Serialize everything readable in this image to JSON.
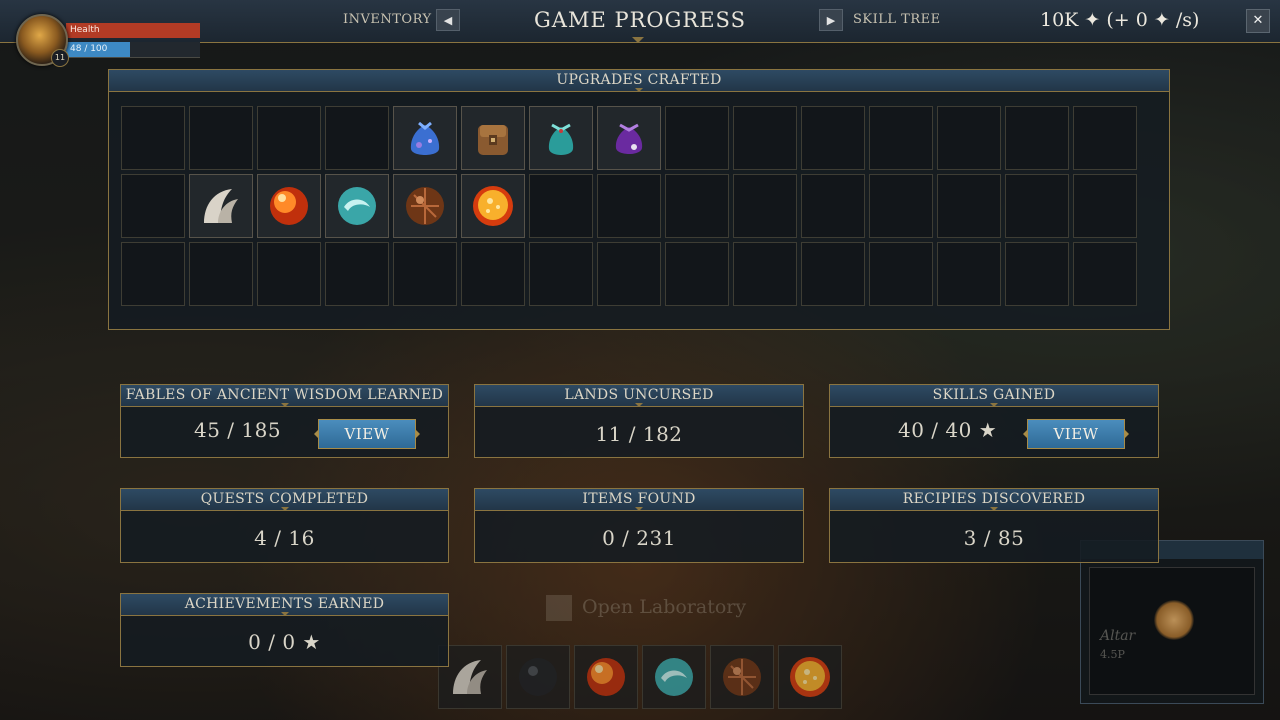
{
  "hud": {
    "level": "11",
    "health_label": "Health",
    "mana_value": "48 / 100",
    "mana_fraction": 0.48
  },
  "topbar": {
    "inventory_label": "INVENTORY",
    "title": "GAME PROGRESS",
    "skill_tree_label": "SKILL TREE",
    "currency": "10K ✦ (+ 0 ✦ /s)",
    "prev_icon": "triangle-left-icon",
    "next_icon": "triangle-right-icon",
    "close_icon": "close-icon"
  },
  "upgrades": {
    "title": "UPGRADES CRAFTED",
    "slots": [
      "",
      "",
      "",
      "",
      "blue-pouch",
      "leather-backpack",
      "teal-pouch",
      "purple-pouch",
      "",
      "",
      "",
      "",
      "",
      "",
      "",
      "",
      "claw",
      "fire-orb",
      "water-orb",
      "bronze-orb",
      "sun-orb",
      "",
      "",
      "",
      "",
      "",
      "",
      "",
      "",
      "",
      "",
      "",
      "",
      "",
      "",
      "",
      "",
      "",
      "",
      "",
      "",
      "",
      "",
      "",
      ""
    ]
  },
  "stats": {
    "fables": {
      "title": "FABLES OF ANCIENT WISDOM LEARNED",
      "value": "45 / 185",
      "button": "VIEW"
    },
    "lands": {
      "title": "LANDS UNCURSED",
      "value": "11 / 182"
    },
    "skills": {
      "title": "SKILLS GAINED",
      "value": "40 / 40 ★",
      "button": "VIEW"
    },
    "quests": {
      "title": "QUESTS COMPLETED",
      "value": "4 / 16"
    },
    "items": {
      "title": "ITEMS FOUND",
      "value": "0 / 231"
    },
    "recipes": {
      "title": "RECIPIES DISCOVERED",
      "value": "3 / 85"
    },
    "achievements": {
      "title": "ACHIEVEMENTS EARNED",
      "value": "0 / 0 ★"
    }
  },
  "background": {
    "lab_hint": "Open Laboratory",
    "hotbar": [
      "claw",
      "dark-orb",
      "fire-orb",
      "water-orb",
      "bronze-orb",
      "sun-orb"
    ],
    "sidebox_title": "Altar",
    "sidebox_sub": "4.5P"
  }
}
